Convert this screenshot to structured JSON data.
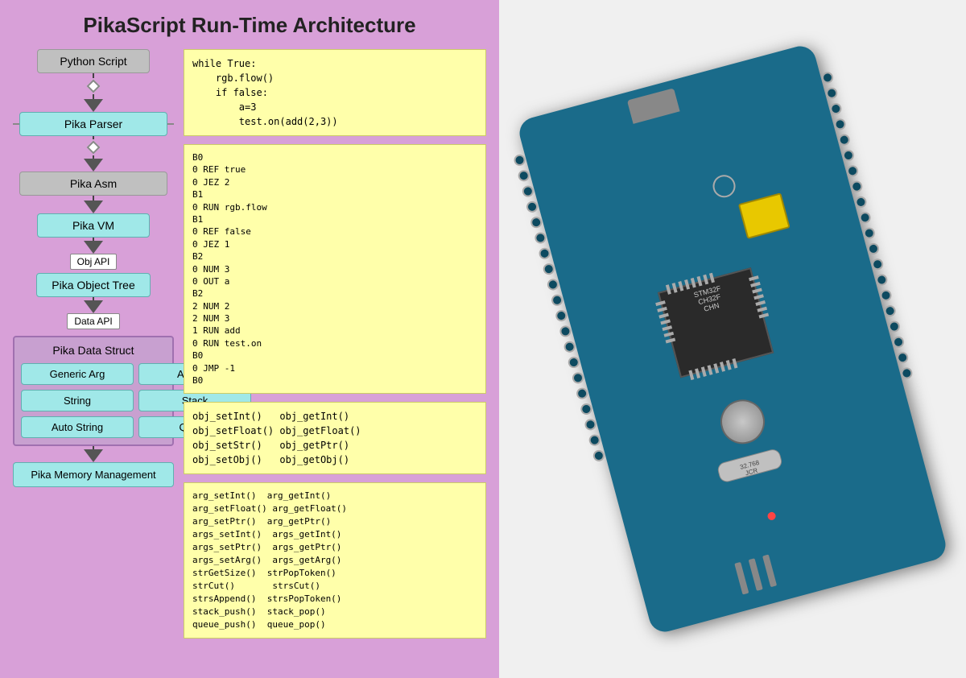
{
  "title": "PikaScript Run-Time Architecture",
  "flow": {
    "items": [
      {
        "id": "python-script",
        "label": "Python Script",
        "type": "gray"
      },
      {
        "id": "pika-parser",
        "label": "Pika Parser",
        "type": "cyan"
      },
      {
        "id": "pika-asm",
        "label": "Pika Asm",
        "type": "gray"
      },
      {
        "id": "pika-vm",
        "label": "Pika VM",
        "type": "cyan"
      },
      {
        "id": "pika-object-tree",
        "label": "Pika Object Tree",
        "type": "cyan"
      },
      {
        "id": "pika-data-struct",
        "label": "Pika Data Struct",
        "type": "cyan"
      }
    ],
    "api_labels": [
      {
        "id": "obj-api",
        "label": "Obj API"
      },
      {
        "id": "data-api",
        "label": "Data API"
      }
    ],
    "data_items": [
      {
        "label": "Generic Arg"
      },
      {
        "label": "Arg List"
      },
      {
        "label": "String"
      },
      {
        "label": "Stack"
      },
      {
        "label": "Auto String"
      },
      {
        "label": "Queue"
      }
    ],
    "memory": "Pika Memory Management"
  },
  "code_blocks": {
    "block1": "while True:\n    rgb.flow()\n    if false:\n        a=3\n        test.on(add(2,3))",
    "block2": "B0\n0 REF true\n0 JEZ 2\nB1\n0 RUN rgb.flow\nB1\n0 REF false\n0 JEZ 1\nB2\n0 NUM 3\n0 OUT a\nB2\n2 NUM 2\n2 NUM 3\n1 RUN add\n0 RUN test.on\nB0\n0 JMP -1\nB0",
    "block3": "obj_setInt()   obj_getInt()\nobj_setFloat() obj_getFloat()\nobj_setStr()   obj_getPtr()\nobj_setObj()   obj_getObj()",
    "block4": "arg_setInt()  arg_getInt()\narg_setFloat() arg_getFloat()\narg_setPtr()  arg_getPtr()\nargs_setInt()  args_getInt()\nargs_setPtr()  args_getPtr()\nargs_setArg()  args_getArg()\nstrGetSize()  strPopToken()\nstrCut()       strsCut()\nstrsAppend()  strsPopToken()\nstack_push()  stack_pop()\nqueue_push()  queue_pop()"
  }
}
